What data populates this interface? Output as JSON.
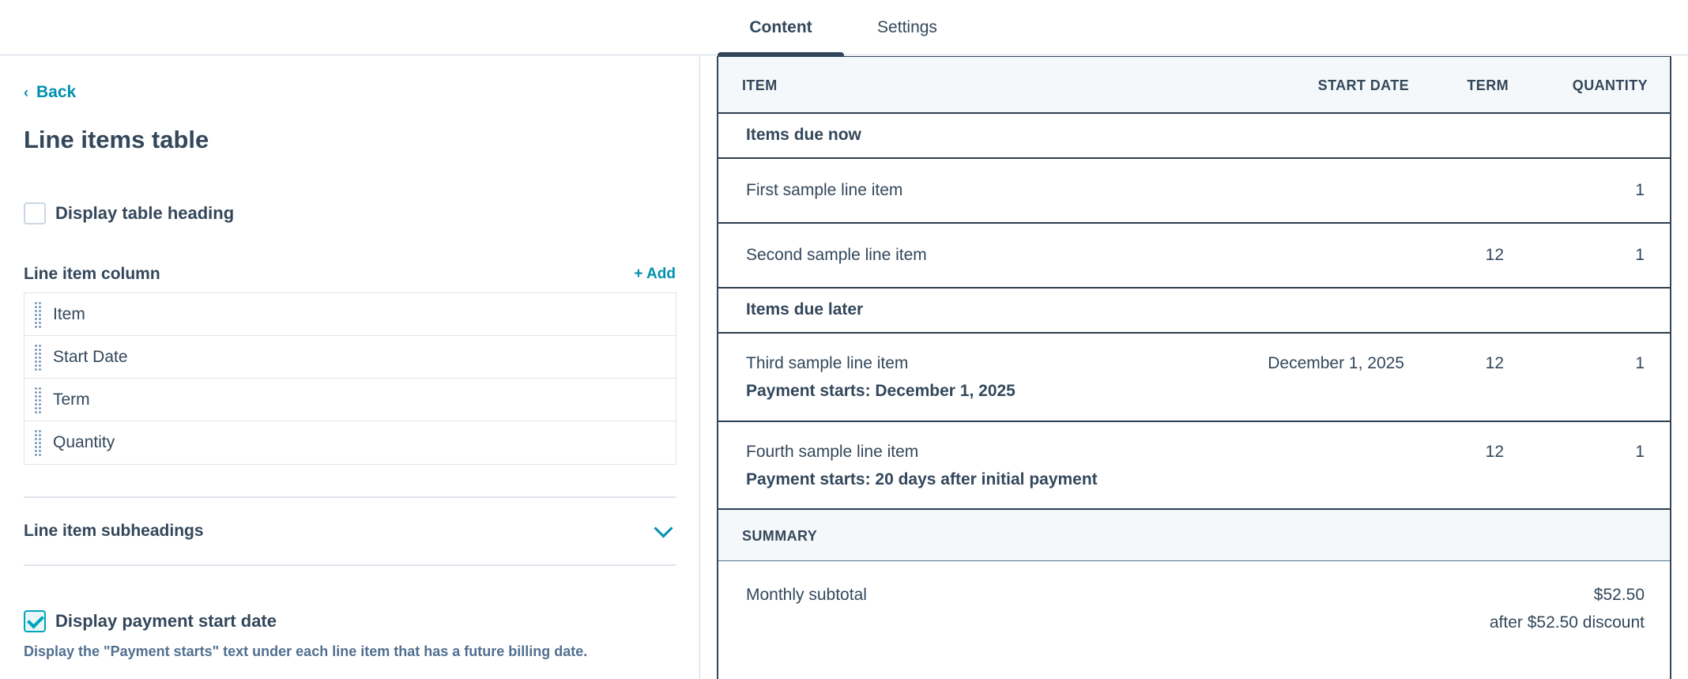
{
  "tabs": [
    {
      "label": "Content",
      "active": true
    },
    {
      "label": "Settings",
      "active": false
    }
  ],
  "left_panel": {
    "back_label": "Back",
    "title": "Line items table",
    "display_table_heading": {
      "label": "Display table heading",
      "checked": false
    },
    "line_item_column": {
      "label": "Line item column",
      "add_label": "+ Add",
      "items": [
        "Item",
        "Start Date",
        "Term",
        "Quantity"
      ]
    },
    "subheadings_label": "Line item subheadings",
    "display_payment_start": {
      "label": "Display payment start date",
      "checked": true
    },
    "help_text": "Display the \"Payment starts\" text under each line item that has a future billing date."
  },
  "preview": {
    "headers": {
      "item": "ITEM",
      "start_date": "START DATE",
      "term": "TERM",
      "quantity": "QUANTITY"
    },
    "group_now": "Items due now",
    "rows_now": [
      {
        "item": "First sample line item",
        "start_date": "",
        "term": "",
        "quantity": "1"
      },
      {
        "item": "Second sample line item",
        "start_date": "",
        "term": "12",
        "quantity": "1"
      }
    ],
    "group_later": "Items due later",
    "rows_later": [
      {
        "item": "Third sample line item",
        "payment": "Payment starts: December 1, 2025",
        "start_date": "December 1, 2025",
        "term": "12",
        "quantity": "1"
      },
      {
        "item": "Fourth sample line item",
        "payment": "Payment starts: 20 days after initial payment",
        "start_date": "",
        "term": "12",
        "quantity": "1"
      }
    ],
    "summary_label": "SUMMARY",
    "summary": {
      "label": "Monthly subtotal",
      "amount": "$52.50",
      "note": "after $52.50 discount"
    }
  },
  "colors": {
    "accent": "#0091ae",
    "text": "#33475b",
    "border": "#2d3e50"
  }
}
